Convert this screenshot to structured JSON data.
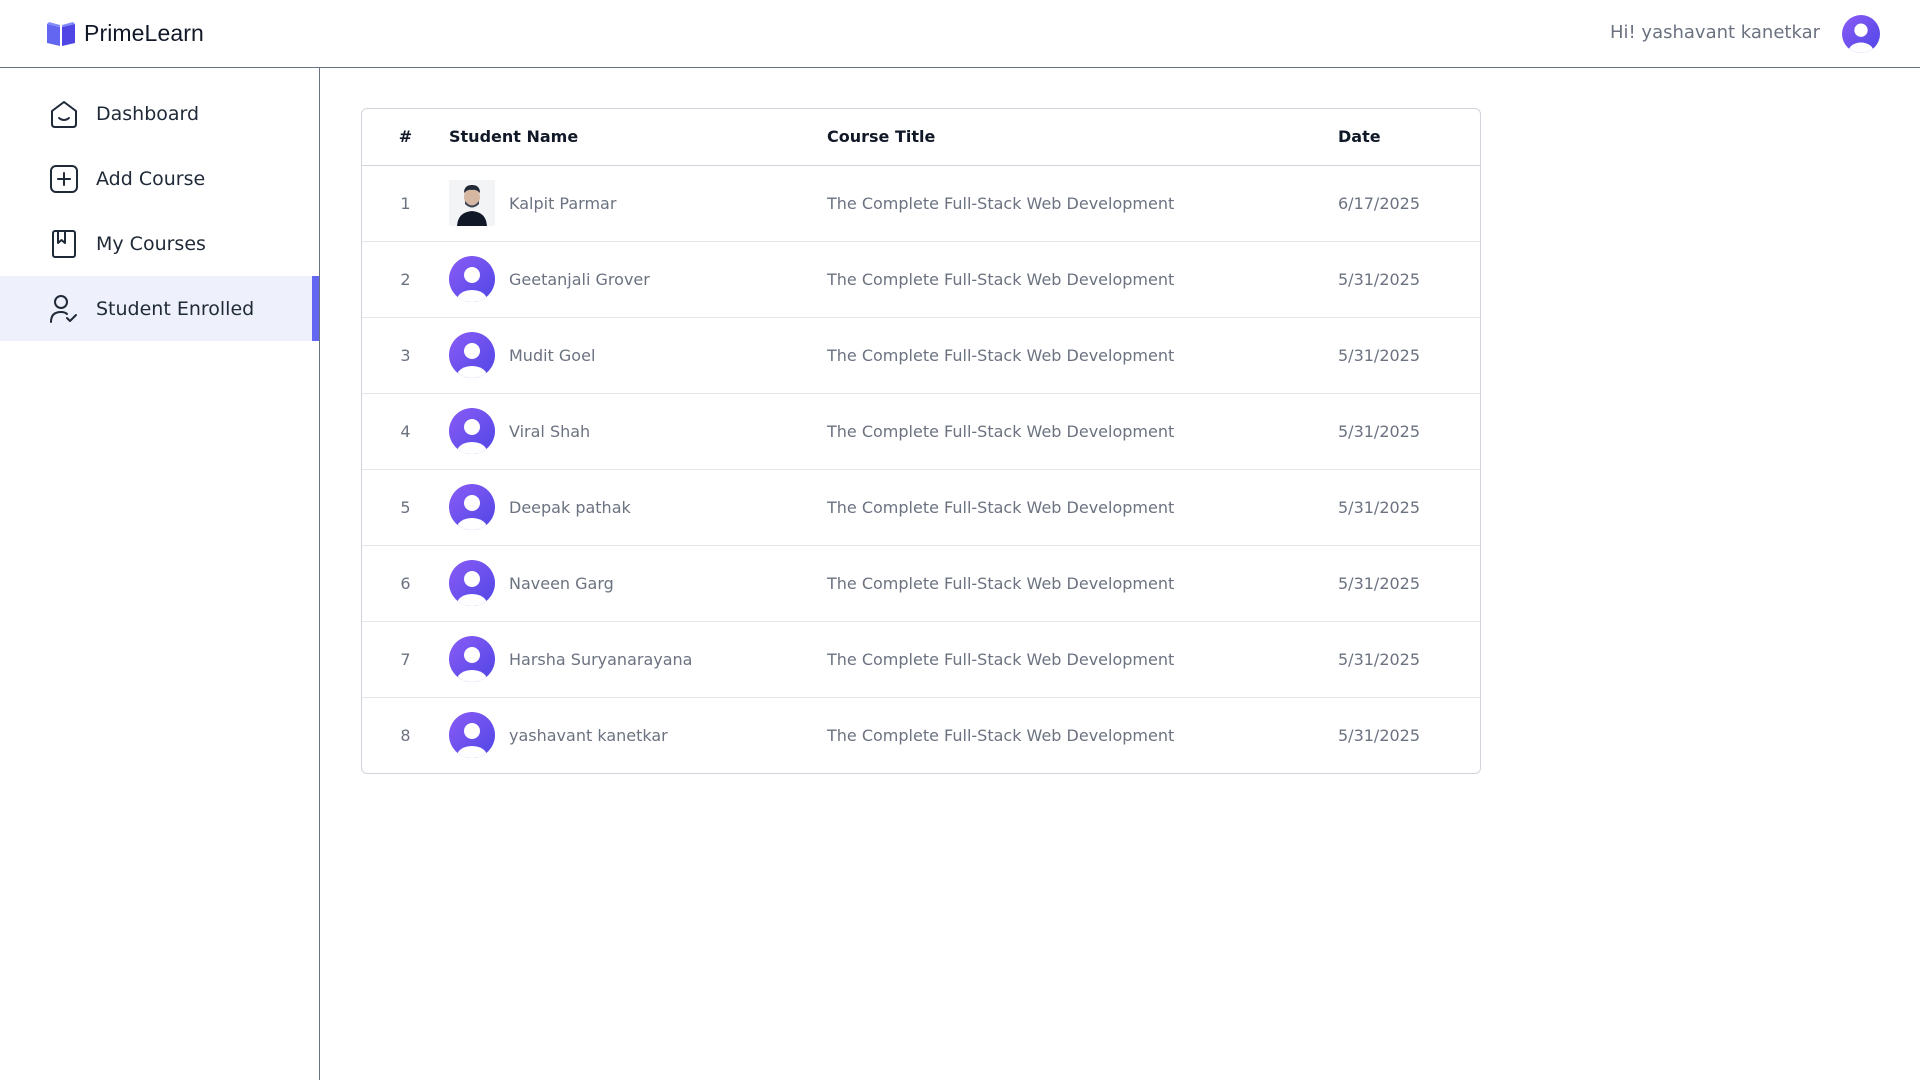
{
  "header": {
    "brand": "PrimeLearn",
    "greeting": "Hi! yashavant kanetkar"
  },
  "colors": {
    "accent": "#6366f1",
    "avatar_gradient_start": "#7c3aed",
    "avatar_gradient_end": "#4f46e5",
    "active_nav_bg": "#eef1fb"
  },
  "sidebar": {
    "items": [
      {
        "label": "Dashboard",
        "icon": "home-icon",
        "active": false
      },
      {
        "label": "Add Course",
        "icon": "add-square-icon",
        "active": false
      },
      {
        "label": "My Courses",
        "icon": "bookmark-book-icon",
        "active": false
      },
      {
        "label": "Student Enrolled",
        "icon": "user-check-icon",
        "active": true
      }
    ]
  },
  "table": {
    "headers": [
      "#",
      "Student Name",
      "Course Title",
      "Date"
    ],
    "rows": [
      {
        "num": "1",
        "name": "Kalpit Parmar",
        "course": "The Complete Full-Stack Web Development",
        "date": "6/17/2025",
        "avatar": "photo"
      },
      {
        "num": "2",
        "name": "Geetanjali Grover",
        "course": "The Complete Full-Stack Web Development",
        "date": "5/31/2025",
        "avatar": "default"
      },
      {
        "num": "3",
        "name": "Mudit Goel",
        "course": "The Complete Full-Stack Web Development",
        "date": "5/31/2025",
        "avatar": "default"
      },
      {
        "num": "4",
        "name": "Viral Shah",
        "course": "The Complete Full-Stack Web Development",
        "date": "5/31/2025",
        "avatar": "default"
      },
      {
        "num": "5",
        "name": "Deepak pathak",
        "course": "The Complete Full-Stack Web Development",
        "date": "5/31/2025",
        "avatar": "default"
      },
      {
        "num": "6",
        "name": "Naveen Garg",
        "course": "The Complete Full-Stack Web Development",
        "date": "5/31/2025",
        "avatar": "default"
      },
      {
        "num": "7",
        "name": "Harsha Suryanarayana",
        "course": "The Complete Full-Stack Web Development",
        "date": "5/31/2025",
        "avatar": "default"
      },
      {
        "num": "8",
        "name": "yashavant kanetkar",
        "course": "The Complete Full-Stack Web Development",
        "date": "5/31/2025",
        "avatar": "default"
      }
    ]
  }
}
